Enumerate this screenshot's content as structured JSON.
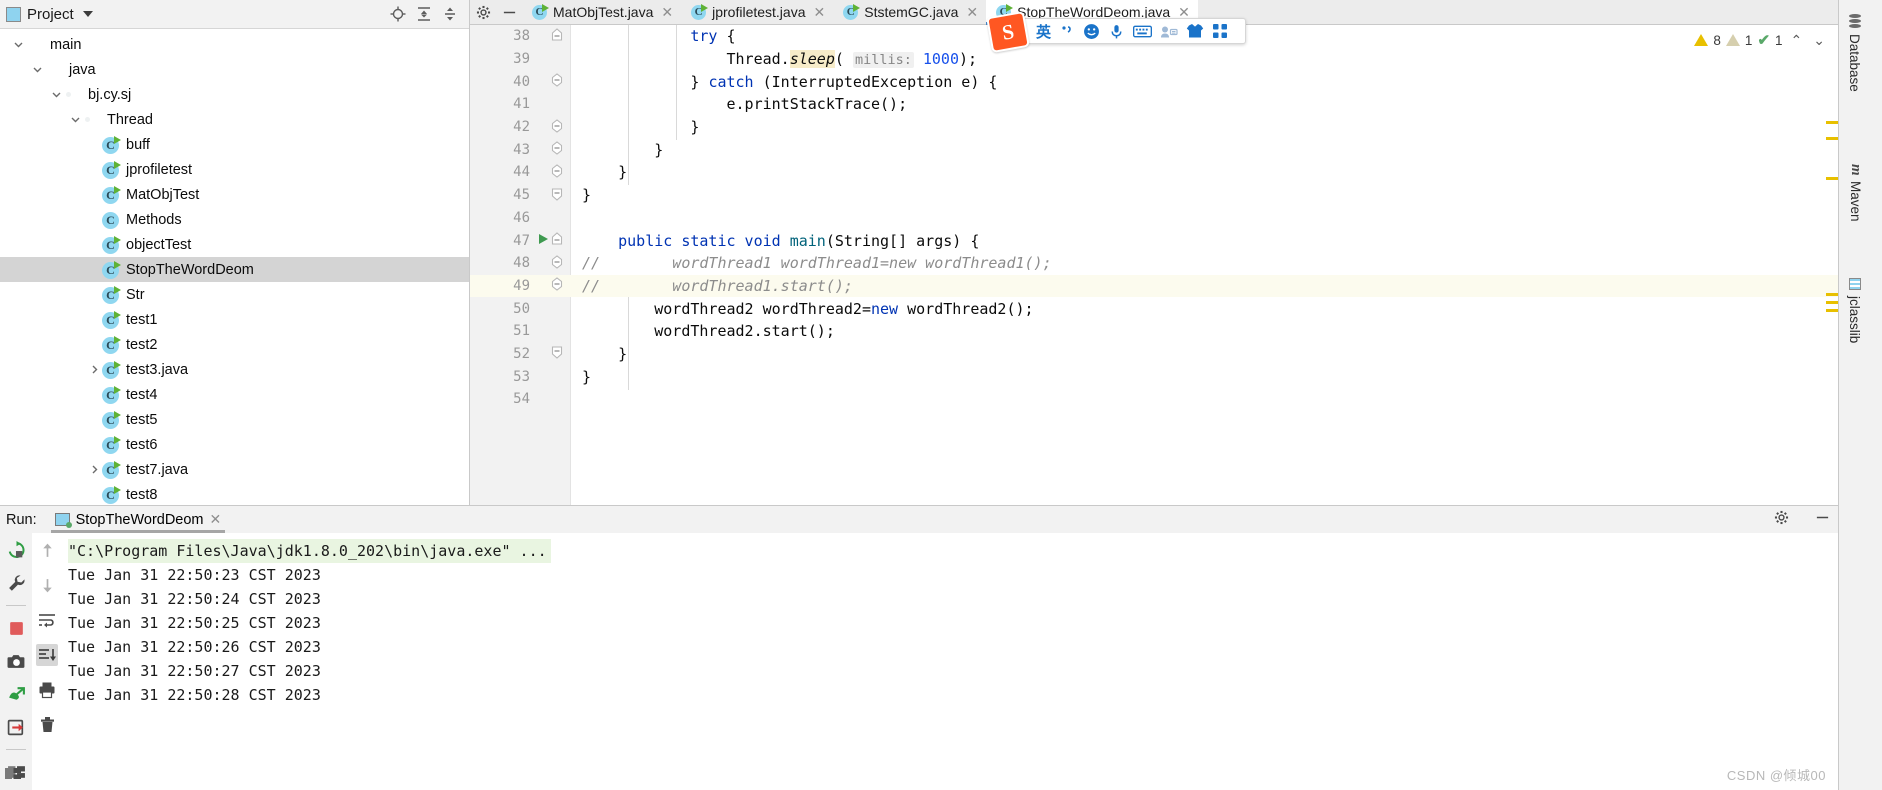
{
  "project_panel": {
    "title": "Project",
    "header_buttons": [
      {
        "name": "locate-icon",
        "glyph": "⊕"
      },
      {
        "name": "expand-all-icon",
        "glyph": "⤒"
      },
      {
        "name": "collapse-all-icon",
        "glyph": "⤓"
      }
    ],
    "tree": [
      {
        "label": "main",
        "depth": 1,
        "type": "folder-grey",
        "chevron": "down",
        "selected": false
      },
      {
        "label": "java",
        "depth": 2,
        "type": "folder-blue",
        "chevron": "down",
        "selected": false
      },
      {
        "label": "bj.cy.sj",
        "depth": 3,
        "type": "package",
        "chevron": "down",
        "selected": false
      },
      {
        "label": "Thread",
        "depth": 4,
        "type": "package",
        "chevron": "down",
        "selected": false
      },
      {
        "label": "buff",
        "depth": 5,
        "type": "class-run",
        "chevron": "none",
        "selected": false
      },
      {
        "label": "jprofiletest",
        "depth": 5,
        "type": "class-run",
        "chevron": "none",
        "selected": false
      },
      {
        "label": "MatObjTest",
        "depth": 5,
        "type": "class-run",
        "chevron": "none",
        "selected": false
      },
      {
        "label": "Methods",
        "depth": 5,
        "type": "class",
        "chevron": "none",
        "selected": false
      },
      {
        "label": "objectTest",
        "depth": 5,
        "type": "class-run",
        "chevron": "none",
        "selected": false
      },
      {
        "label": "StopTheWordDeom",
        "depth": 5,
        "type": "class-run",
        "chevron": "none",
        "selected": true
      },
      {
        "label": "Str",
        "depth": 5,
        "type": "class-run",
        "chevron": "none",
        "selected": false
      },
      {
        "label": "test1",
        "depth": 5,
        "type": "class-run",
        "chevron": "none",
        "selected": false
      },
      {
        "label": "test2",
        "depth": 5,
        "type": "class-run",
        "chevron": "none",
        "selected": false
      },
      {
        "label": "test3.java",
        "depth": 5,
        "type": "class-run",
        "chevron": "right",
        "selected": false
      },
      {
        "label": "test4",
        "depth": 5,
        "type": "class-run",
        "chevron": "none",
        "selected": false
      },
      {
        "label": "test5",
        "depth": 5,
        "type": "class-run",
        "chevron": "none",
        "selected": false
      },
      {
        "label": "test6",
        "depth": 5,
        "type": "class-run",
        "chevron": "none",
        "selected": false
      },
      {
        "label": "test7.java",
        "depth": 5,
        "type": "class-run",
        "chevron": "right",
        "selected": false
      },
      {
        "label": "test8",
        "depth": 5,
        "type": "class-run",
        "chevron": "none",
        "selected": false
      }
    ]
  },
  "editor": {
    "toolbar_icons": [
      {
        "name": "settings-gear-icon",
        "glyph": "✿"
      },
      {
        "name": "hide-icon",
        "glyph": "—"
      }
    ],
    "tabs": [
      {
        "label": "MatObjTest.java",
        "active": false
      },
      {
        "label": "jprofiletest.java",
        "active": false
      },
      {
        "label": "StstemGC.java",
        "active": false
      },
      {
        "label": "StopTheWordDeom.java",
        "active": true
      }
    ],
    "inspections": {
      "warning_count": "8",
      "weak_warning_count": "1",
      "ok_count": "1"
    },
    "code": [
      {
        "num": "38",
        "fold": "minus-top",
        "run": false,
        "hl": false,
        "parts": [
          {
            "t": "            ",
            "c": "plain"
          },
          {
            "t": "try",
            "c": "kw"
          },
          {
            "t": " {",
            "c": "plain"
          }
        ]
      },
      {
        "num": "39",
        "fold": "none",
        "run": false,
        "hl": false,
        "parts": [
          {
            "t": "                Thread.",
            "c": "plain"
          },
          {
            "t": "sleep",
            "c": "usage"
          },
          {
            "t": "( ",
            "c": "plain"
          },
          {
            "t": "millis:",
            "c": "hint"
          },
          {
            "t": " ",
            "c": "plain"
          },
          {
            "t": "1000",
            "c": "num"
          },
          {
            "t": ");",
            "c": "plain"
          }
        ]
      },
      {
        "num": "40",
        "fold": "minus-mid",
        "run": false,
        "hl": false,
        "parts": [
          {
            "t": "            } ",
            "c": "plain"
          },
          {
            "t": "catch",
            "c": "kw"
          },
          {
            "t": " (InterruptedException e) {",
            "c": "plain"
          }
        ]
      },
      {
        "num": "41",
        "fold": "none",
        "run": false,
        "hl": false,
        "parts": [
          {
            "t": "                e.printStackTrace();",
            "c": "plain"
          }
        ]
      },
      {
        "num": "42",
        "fold": "minus-mid",
        "run": false,
        "hl": false,
        "parts": [
          {
            "t": "            }",
            "c": "plain"
          }
        ]
      },
      {
        "num": "43",
        "fold": "minus-mid",
        "run": false,
        "hl": false,
        "parts": [
          {
            "t": "        }",
            "c": "plain"
          }
        ]
      },
      {
        "num": "44",
        "fold": "minus-mid",
        "run": false,
        "hl": false,
        "parts": [
          {
            "t": "    }",
            "c": "plain"
          }
        ]
      },
      {
        "num": "45",
        "fold": "minus-end",
        "run": false,
        "hl": false,
        "parts": [
          {
            "t": "}",
            "c": "plain"
          }
        ]
      },
      {
        "num": "46",
        "fold": "none",
        "run": false,
        "hl": false,
        "parts": [
          {
            "t": "",
            "c": "plain"
          }
        ]
      },
      {
        "num": "47",
        "fold": "minus-top",
        "run": true,
        "hl": false,
        "parts": [
          {
            "t": "    ",
            "c": "plain"
          },
          {
            "t": "public static void",
            "c": "kw"
          },
          {
            "t": " ",
            "c": "plain"
          },
          {
            "t": "main",
            "c": "method"
          },
          {
            "t": "(String[] args) {",
            "c": "plain"
          }
        ]
      },
      {
        "num": "48",
        "fold": "minus-mid",
        "run": false,
        "hl": false,
        "parts": [
          {
            "t": "//        wordThread1 wordThread1=new wordThread1();",
            "c": "cmt"
          }
        ]
      },
      {
        "num": "49",
        "fold": "minus-mid",
        "run": false,
        "hl": true,
        "parts": [
          {
            "t": "//        wordThread1.start();",
            "c": "cmt"
          }
        ]
      },
      {
        "num": "50",
        "fold": "none",
        "run": false,
        "hl": false,
        "parts": [
          {
            "t": "        wordThread2 wordThread2=",
            "c": "plain"
          },
          {
            "t": "new",
            "c": "kw"
          },
          {
            "t": " wordThread2();",
            "c": "plain"
          }
        ]
      },
      {
        "num": "51",
        "fold": "none",
        "run": false,
        "hl": false,
        "parts": [
          {
            "t": "        wordThread2.start();",
            "c": "plain"
          }
        ]
      },
      {
        "num": "52",
        "fold": "minus-end",
        "run": false,
        "hl": false,
        "parts": [
          {
            "t": "    }",
            "c": "plain"
          }
        ]
      },
      {
        "num": "53",
        "fold": "none",
        "run": false,
        "hl": false,
        "parts": [
          {
            "t": "}",
            "c": "plain"
          }
        ]
      },
      {
        "num": "54",
        "fold": "none",
        "run": false,
        "hl": false,
        "parts": [
          {
            "t": "",
            "c": "plain"
          }
        ]
      }
    ]
  },
  "ime_toolbar": {
    "logo_text": "S",
    "items": [
      {
        "name": "language-mode-english",
        "glyph": "英"
      },
      {
        "name": "punctuation-mode-icon",
        "glyph": "·,"
      },
      {
        "name": "emoji-icon",
        "glyph": "☺"
      },
      {
        "name": "voice-input-icon",
        "glyph": "🎤"
      },
      {
        "name": "soft-keyboard-icon",
        "glyph": "⌨"
      },
      {
        "name": "user-card-icon",
        "glyph": "▤"
      },
      {
        "name": "skin-shirt-icon",
        "glyph": "👕"
      },
      {
        "name": "app-grid-icon",
        "glyph": "▦"
      }
    ]
  },
  "right_sidebar": {
    "tools": [
      {
        "label": "Database",
        "icon": "database-icon"
      },
      {
        "label": "Maven",
        "icon": "maven-icon"
      },
      {
        "label": "jclasslib",
        "icon": "jclasslib-icon"
      }
    ]
  },
  "run_panel": {
    "label": "Run:",
    "tab_label": "StopTheWordDeom",
    "header_icons": [
      {
        "name": "settings-gear-icon",
        "glyph": "✿"
      },
      {
        "name": "hide-panel-icon",
        "glyph": "—"
      }
    ],
    "left_toolbar": [
      {
        "name": "rerun-button",
        "glyph": "↻"
      },
      {
        "name": "configure-button",
        "glyph": "🔧"
      },
      {
        "name": "stop-button",
        "glyph": "■"
      },
      {
        "name": "screenshot-button",
        "glyph": "📷"
      },
      {
        "name": "thread-dump-button",
        "glyph": "⇱"
      },
      {
        "name": "export-button",
        "glyph": "⇥"
      },
      {
        "name": "layout-button",
        "glyph": "▤"
      }
    ],
    "second_toolbar": [
      {
        "name": "scroll-up-button",
        "glyph": "↑"
      },
      {
        "name": "scroll-down-button",
        "glyph": "↓"
      },
      {
        "name": "soft-wrap-button",
        "glyph": "⇥"
      },
      {
        "name": "scroll-to-end-button",
        "glyph": "⇟"
      },
      {
        "name": "print-button",
        "glyph": "🖶"
      },
      {
        "name": "clear-all-button",
        "glyph": "🗑"
      }
    ],
    "console": [
      {
        "text": "\"C:\\Program Files\\Java\\jdk1.8.0_202\\bin\\java.exe\" ...",
        "cmd": true
      },
      {
        "text": "Tue Jan 31 22:50:23 CST 2023",
        "cmd": false
      },
      {
        "text": "Tue Jan 31 22:50:24 CST 2023",
        "cmd": false
      },
      {
        "text": "Tue Jan 31 22:50:25 CST 2023",
        "cmd": false
      },
      {
        "text": "Tue Jan 31 22:50:26 CST 2023",
        "cmd": false
      },
      {
        "text": "Tue Jan 31 22:50:27 CST 2023",
        "cmd": false
      },
      {
        "text": "Tue Jan 31 22:50:28 CST 2023",
        "cmd": false
      }
    ]
  },
  "watermark": "CSDN @倾城00",
  "colors": {
    "accent_blue": "#4a86c8",
    "keyword": "#0033b3",
    "comment": "#8c8c8c",
    "warning": "#e8c000",
    "ok_green": "#59a869",
    "selection": "#d4d4d4"
  }
}
